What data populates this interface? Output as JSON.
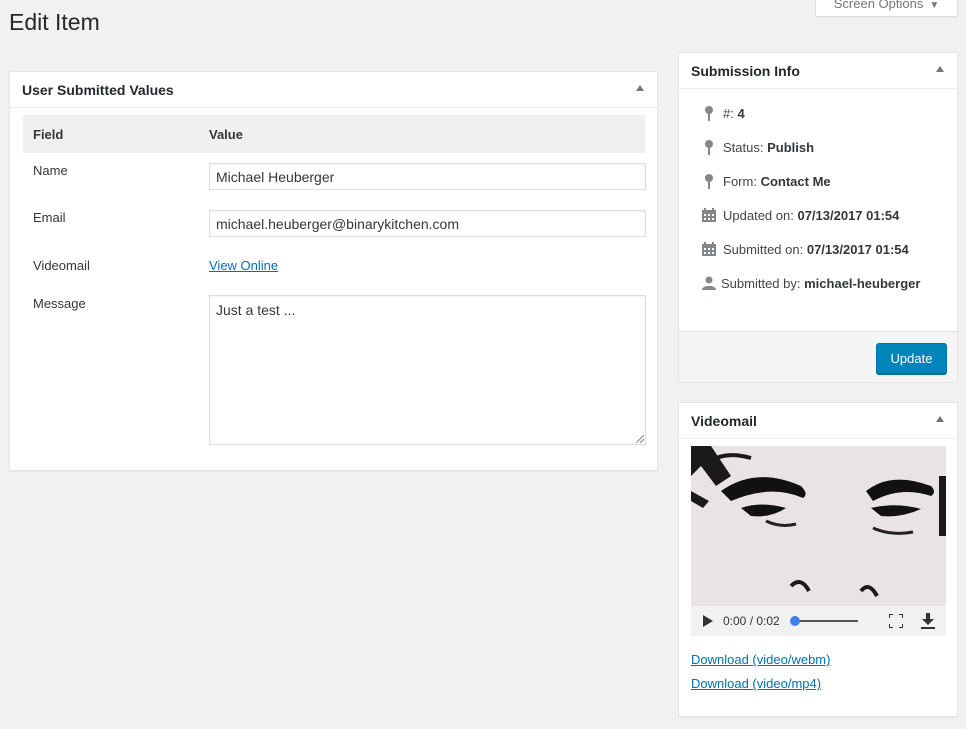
{
  "page": {
    "title": "Edit Item"
  },
  "screen_options": {
    "label": "Screen Options"
  },
  "main_box": {
    "title": "User Submitted Values",
    "headers": {
      "field": "Field",
      "value": "Value"
    },
    "rows": {
      "name": {
        "label": "Name",
        "value": "Michael Heuberger"
      },
      "email": {
        "label": "Email",
        "value": "michael.heuberger@binarykitchen.com"
      },
      "videomail": {
        "label": "Videomail",
        "link": "View Online"
      },
      "message": {
        "label": "Message",
        "value": "Just a test ..."
      }
    }
  },
  "info_box": {
    "title": "Submission Info",
    "id": {
      "label": "#:",
      "value": "4"
    },
    "status": {
      "label": "Status:",
      "value": "Publish"
    },
    "form": {
      "label": "Form:",
      "value": "Contact Me"
    },
    "updated": {
      "label": "Updated on:",
      "value": "07/13/2017 01:54"
    },
    "submitted": {
      "label": "Submitted on:",
      "value": "07/13/2017 01:54"
    },
    "submitted_by": {
      "label": "Submitted by:",
      "value": "michael-heuberger"
    },
    "update_button": "Update"
  },
  "video_box": {
    "title": "Videomail",
    "time": "0:00 / 0:02",
    "progress": 0,
    "download_webm": "Download (video/webm)",
    "download_mp4": "Download (video/mp4)"
  },
  "colors": {
    "accent": "#0085ba",
    "link": "#0073aa",
    "background": "#f1f1f1"
  },
  "icons": [
    "pin-icon",
    "calendar-icon",
    "user-icon",
    "triangle-up-icon",
    "play-icon",
    "fullscreen-icon",
    "download-icon"
  ]
}
